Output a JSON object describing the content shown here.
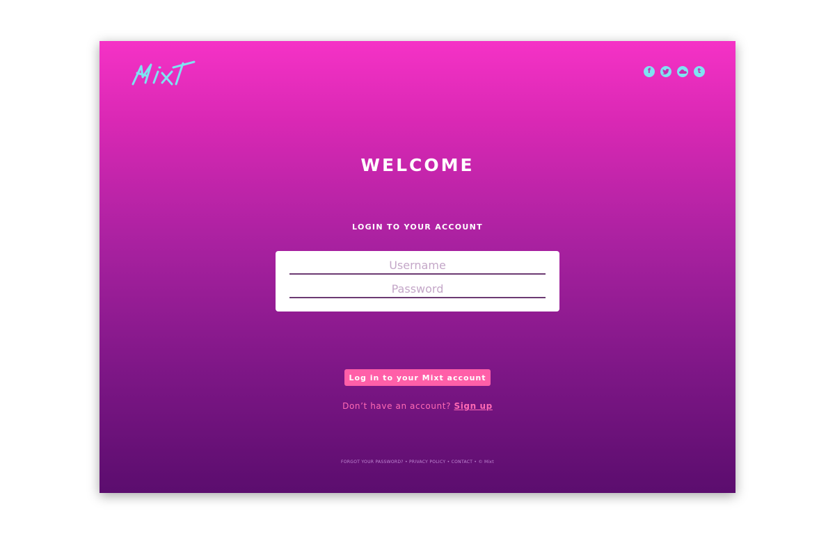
{
  "brand": {
    "logo_text": "Mixt",
    "logo_color": "#7fe3f2"
  },
  "colors": {
    "gradient_top": "#f532c6",
    "gradient_bottom": "#5b0d6e",
    "accent_button": "#ff5fa8",
    "link_pink": "#ff6ab4",
    "icon_cyan": "#7fe3f2"
  },
  "social": [
    {
      "name": "facebook-icon",
      "glyph": "f"
    },
    {
      "name": "twitter-icon",
      "glyph": "bird"
    },
    {
      "name": "soundcloud-icon",
      "glyph": "cloud"
    },
    {
      "name": "tumblr-icon",
      "glyph": "t"
    }
  ],
  "main": {
    "welcome": "WELCOME",
    "login_heading": "LOGIN TO YOUR ACCOUNT"
  },
  "form": {
    "username_placeholder": "Username",
    "username_value": "",
    "password_placeholder": "Password",
    "password_value": ""
  },
  "actions": {
    "login_label": "Log in to your Mixt account",
    "no_account_text": "Don’t have an account?",
    "signup_label": "Sign up"
  },
  "footer": {
    "forgot": "FORGOT YOUR PASSWORD?",
    "privacy": "PRIVACY POLICY",
    "contact": "CONTACT",
    "copyright": "© Mixt",
    "separator": "•"
  }
}
